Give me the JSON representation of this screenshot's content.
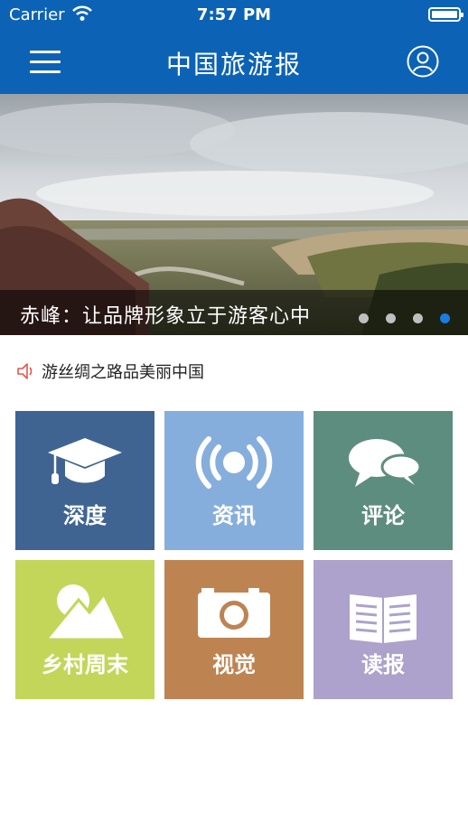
{
  "status_bar": {
    "carrier": "Carrier",
    "time": "7:57 PM"
  },
  "nav": {
    "title": "中国旅游报",
    "menu_icon": "hamburger-menu-icon",
    "user_icon": "user-profile-icon"
  },
  "banner": {
    "caption": "赤峰：让品牌形象立于游客心中",
    "slide_count": 4,
    "active_slide": 4
  },
  "notice": {
    "icon": "speaker-icon",
    "text": "游丝绸之路品美丽中国"
  },
  "tiles": [
    {
      "label": "深度",
      "icon": "graduation-cap-icon",
      "color": "#3f6492"
    },
    {
      "label": "资讯",
      "icon": "broadcast-icon",
      "color": "#86aedc"
    },
    {
      "label": "评论",
      "icon": "chat-bubbles-icon",
      "color": "#5d8d7e"
    },
    {
      "label": "乡村周末",
      "icon": "mountain-icon",
      "color": "#c4d65a"
    },
    {
      "label": "视觉",
      "icon": "camera-icon",
      "color": "#bd8452"
    },
    {
      "label": "读报",
      "icon": "newspaper-icon",
      "color": "#aca2cc"
    }
  ],
  "colors": {
    "brand_blue": "#0c63b5",
    "active_dot": "#1a7be0"
  }
}
